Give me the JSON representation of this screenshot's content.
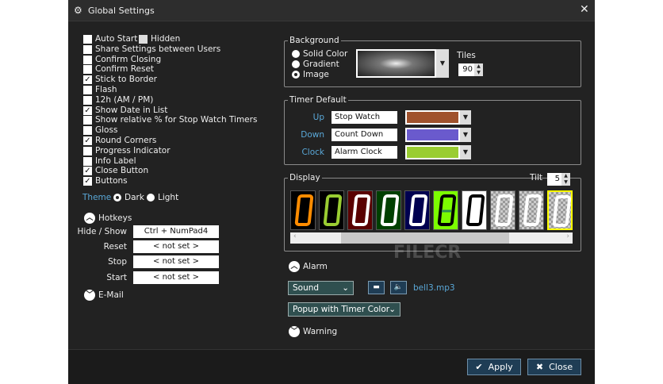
{
  "window": {
    "title": "Global Settings",
    "icon": "gears-icon",
    "close_icon": "close-icon"
  },
  "options": [
    {
      "label": "Auto Start",
      "checked": false
    },
    {
      "label": "Share Settings between Users",
      "checked": false
    },
    {
      "label": "Confirm Closing",
      "checked": false
    },
    {
      "label": "Confirm Reset",
      "checked": false
    },
    {
      "label": "Stick to Border",
      "checked": true
    },
    {
      "label": "Flash",
      "checked": false
    },
    {
      "label": "12h (AM / PM)",
      "checked": false
    },
    {
      "label": "Show Date in List",
      "checked": true
    },
    {
      "label": "Show relative % for Stop Watch Timers",
      "checked": false
    },
    {
      "label": "Gloss",
      "checked": false
    },
    {
      "label": "Round Corners",
      "checked": true
    },
    {
      "label": "Progress Indicator",
      "checked": false
    },
    {
      "label": "Info Label",
      "checked": false
    },
    {
      "label": "Close Button",
      "checked": true
    },
    {
      "label": "Buttons",
      "checked": true
    }
  ],
  "hidden": {
    "label": "Hidden",
    "checked": false
  },
  "theme": {
    "label": "Theme",
    "dark": "Dark",
    "light": "Light",
    "selected": "Dark"
  },
  "hotkeys": {
    "title": "Hotkeys",
    "rows": [
      {
        "label": "Hide / Show",
        "value": "Ctrl + NumPad4"
      },
      {
        "label": "Reset",
        "value": "< not set >"
      },
      {
        "label": "Stop",
        "value": "< not set >"
      },
      {
        "label": "Start",
        "value": "< not set >"
      }
    ]
  },
  "email": {
    "title": "E-Mail"
  },
  "background": {
    "title": "Background",
    "options": [
      "Solid Color",
      "Gradient",
      "Image"
    ],
    "selected": "Image",
    "tiles_label": "Tiles",
    "tiles_value": "90"
  },
  "timer_default": {
    "title": "Timer Default",
    "rows": [
      {
        "label": "Up",
        "name": "Stop Watch",
        "color": "#a0522d"
      },
      {
        "label": "Down",
        "name": "Count Down",
        "color": "#6a5acd"
      },
      {
        "label": "Clock",
        "name": "Alarm Clock",
        "color": "#9acd32"
      }
    ]
  },
  "display": {
    "title": "Display",
    "tilt_label": "Tilt",
    "tilt_value": "5",
    "tiles": [
      {
        "bg": "#000",
        "fg": "#ff8c00"
      },
      {
        "bg": "#000",
        "fg": "#9acd32"
      },
      {
        "bg": "#5a0000",
        "fg": "#fff"
      },
      {
        "bg": "#004000",
        "fg": "#fff"
      },
      {
        "bg": "#000050",
        "fg": "#fff"
      },
      {
        "bg": "#7cfc00",
        "fg": "#000"
      },
      {
        "bg": "#fff",
        "fg": "#000"
      },
      {
        "bg": "checker",
        "fg": "#fff"
      },
      {
        "bg": "checker",
        "fg": "#fff"
      },
      {
        "bg": "checker",
        "fg": "#fff",
        "selected": true
      }
    ]
  },
  "alarm": {
    "title": "Alarm",
    "sound_select": "Sound",
    "file": "bell3.mp3",
    "popup_select": "Popup with Timer Color"
  },
  "warning": {
    "title": "Warning"
  },
  "footer": {
    "apply": "Apply",
    "close": "Close"
  },
  "watermark": "FILECR"
}
